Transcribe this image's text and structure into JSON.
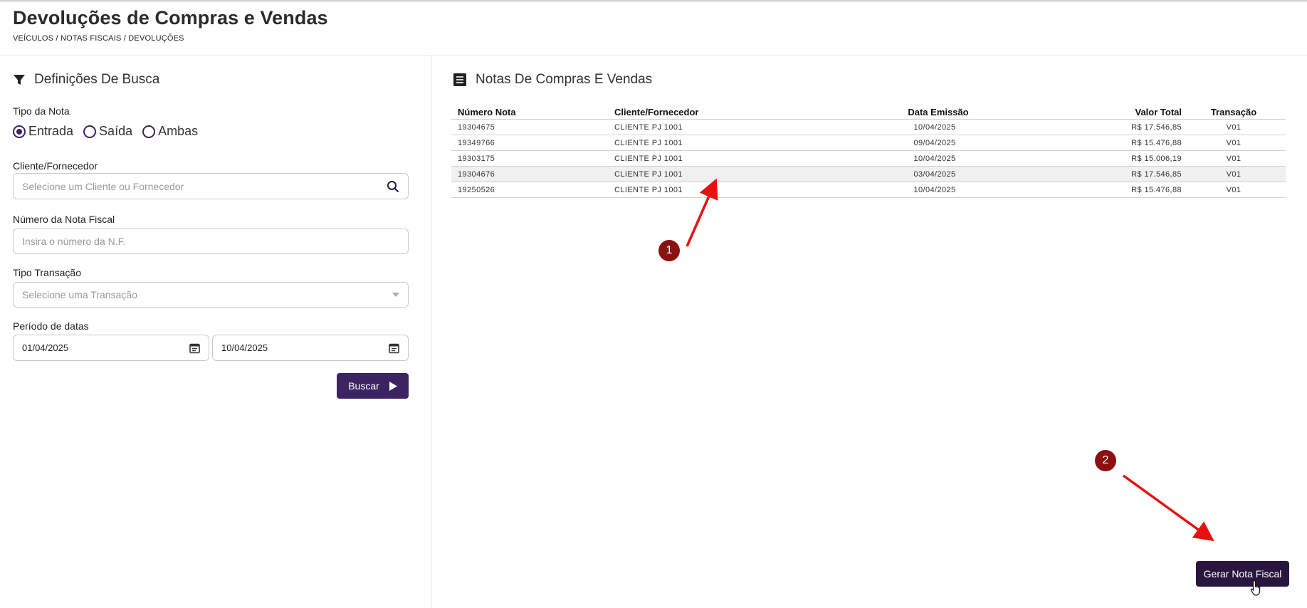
{
  "header": {
    "title": "Devoluções de Compras e Vendas",
    "breadcrumb": "VEÍCULOS / NOTAS FISCAIS / DEVOLUÇÕES"
  },
  "search": {
    "title": "Definições De Busca",
    "tipo_label": "Tipo da Nota",
    "radios": [
      {
        "label": "Entrada",
        "checked": true
      },
      {
        "label": "Saída",
        "checked": false
      },
      {
        "label": "Ambas",
        "checked": false
      }
    ],
    "cliente_label": "Cliente/Fornecedor",
    "cliente_placeholder": "Selecione um Cliente ou Fornecedor",
    "numero_label": "Número da Nota Fiscal",
    "numero_placeholder": "Insira o número da N.F.",
    "transacao_label": "Tipo Transação",
    "transacao_placeholder": "Selecione uma Transação",
    "periodo_label": "Período de datas",
    "date_start": "01/04/2025",
    "date_end": "10/04/2025",
    "buscar_label": "Buscar"
  },
  "notes": {
    "title": "Notas De Compras E Vendas",
    "columns": [
      "Número Nota",
      "Cliente/Fornecedor",
      "Data Emissão",
      "Valor Total",
      "Transação"
    ],
    "rows": [
      [
        "19304675",
        "CLIENTE PJ 1001",
        "10/04/2025",
        "R$ 17.546,85",
        "V01"
      ],
      [
        "19349766",
        "CLIENTE PJ 1001",
        "09/04/2025",
        "R$ 15.476,88",
        "V01"
      ],
      [
        "19303175",
        "CLIENTE PJ 1001",
        "10/04/2025",
        "R$ 15.006,19",
        "V01"
      ],
      [
        "19304676",
        "CLIENTE PJ 1001",
        "03/04/2025",
        "R$ 17.546,85",
        "V01"
      ],
      [
        "19250526",
        "CLIENTE PJ 1001",
        "10/04/2025",
        "R$ 15.476,88",
        "V01"
      ]
    ],
    "highlighted_row": 3
  },
  "annotations": {
    "badge1": "1",
    "badge2": "2",
    "arrow_color": "#e81010"
  },
  "actions": {
    "gerar_label": "Gerar Nota Fiscal"
  },
  "colors": {
    "primary": "#3b2461",
    "primary_dark": "#28163e",
    "badge": "#8b1010"
  }
}
